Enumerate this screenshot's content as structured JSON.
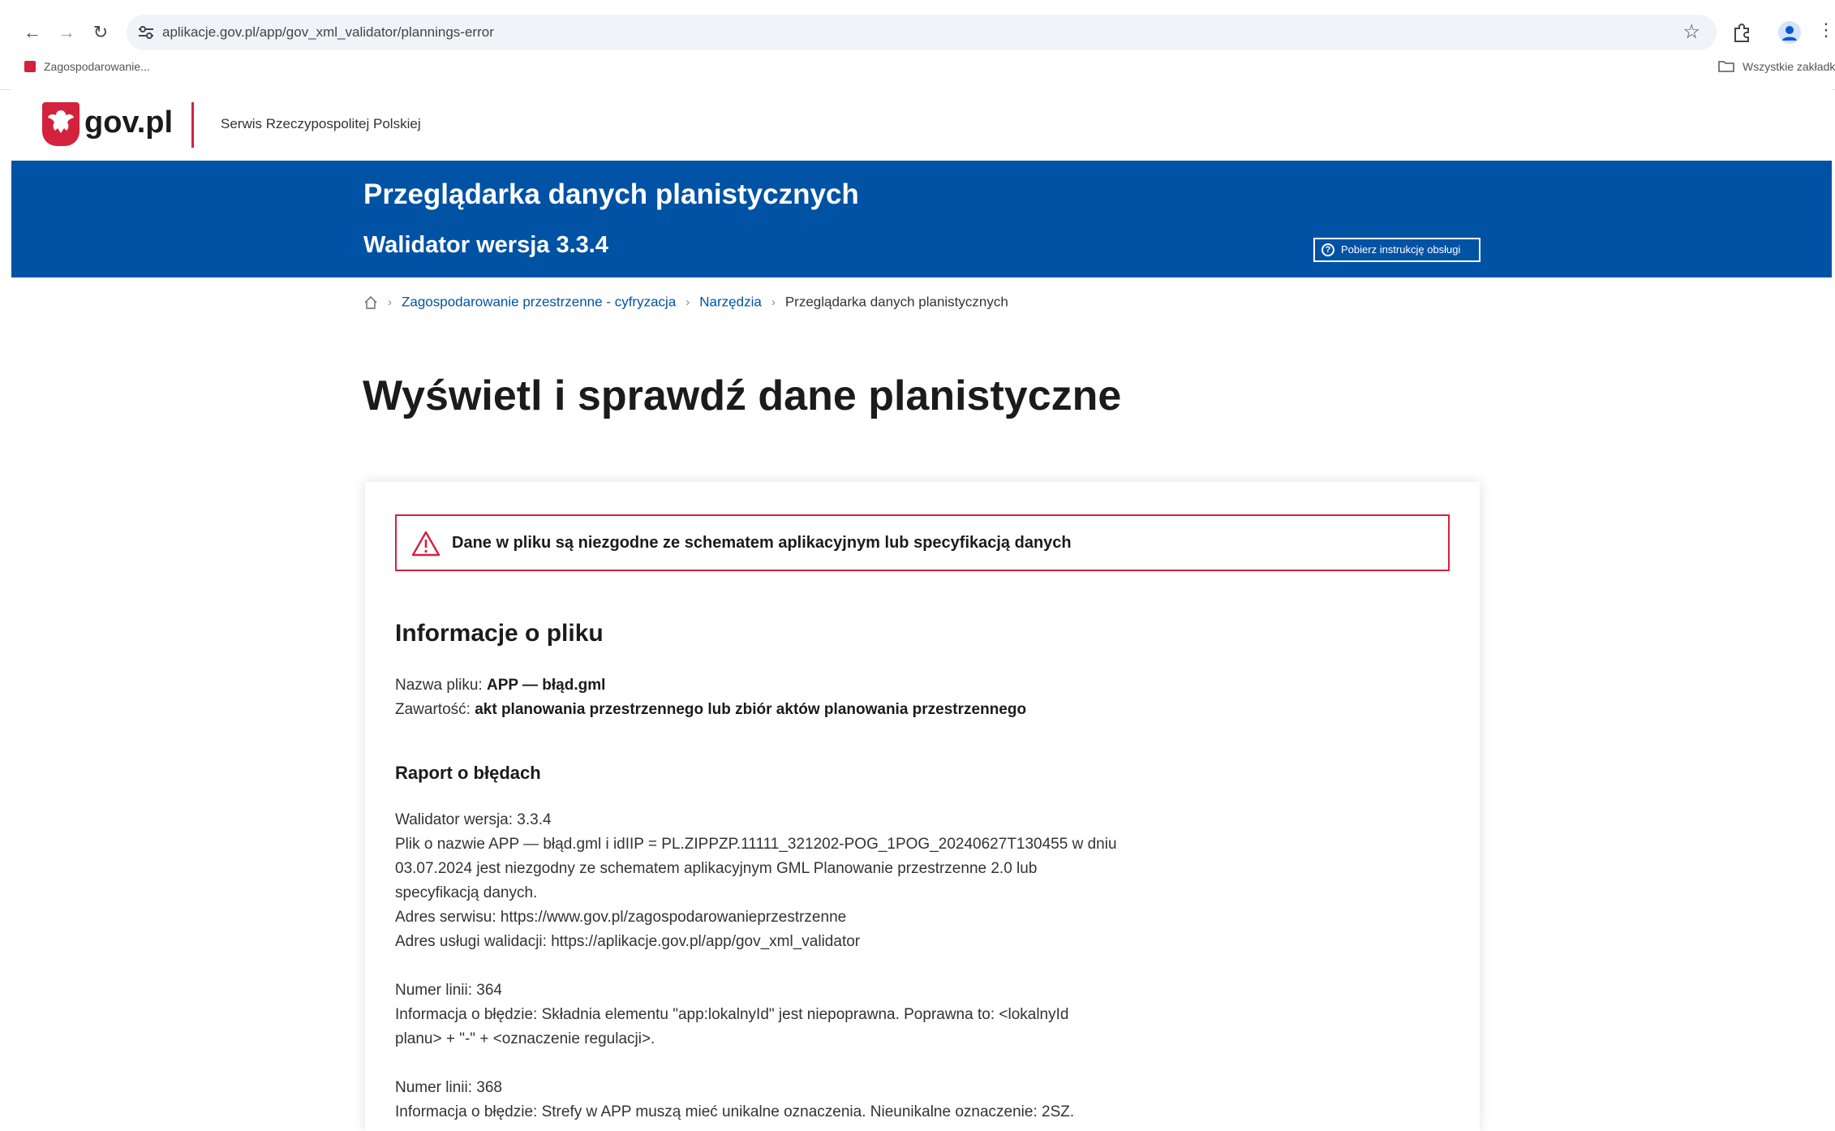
{
  "browser": {
    "url": "aplikacje.gov.pl/app/gov_xml_validator/plannings-error",
    "bookmark": "Zagospodarowanie...",
    "all_bookmarks": "Wszystkie zakładki"
  },
  "gov": {
    "logo_text": "gov.pl",
    "service_name": "Serwis Rzeczypospolitej Polskiej"
  },
  "banner": {
    "title": "Przeglądarka danych planistycznych",
    "subtitle": "Walidator wersja 3.3.4",
    "manual_button": "Pobierz instrukcję obsługi"
  },
  "breadcrumb": {
    "items": [
      "Zagospodarowanie przestrzenne - cyfryzacja",
      "Narzędzia"
    ],
    "current": "Przeglądarka danych planistycznych"
  },
  "page_title": "Wyświetl i sprawdź dane planistyczne",
  "alert": {
    "text": "Dane w pliku są niezgodne ze schematem aplikacyjnym lub specyfikacją danych"
  },
  "file_info": {
    "title": "Informacje o pliku",
    "name_label": "Nazwa pliku:",
    "name_value": "APP — błąd.gml",
    "content_label": "Zawartość:",
    "content_value": "akt planowania przestrzennego lub zbiór aktów planowania przestrzennego"
  },
  "report": {
    "title": "Raport o błędach",
    "summary_lines": [
      "Walidator wersja: 3.3.4",
      "Plik o nazwie APP — błąd.gml i idIIP = PL.ZIPPZP.11111_321202-POG_1POG_20240627T130455 w dniu",
      "03.07.2024 jest niezgodny ze schematem aplikacyjnym GML Planowanie przestrzenne 2.0 lub",
      "specyfikacją danych.",
      "Adres serwisu: https://www.gov.pl/zagospodarowanieprzestrzenne",
      "Adres usługi walidacji: https://aplikacje.gov.pl/app/gov_xml_validator"
    ],
    "error1_lines": [
      "Numer linii: 364",
      "Informacja o błędzie: Składnia elementu \"app:lokalnyId\" jest niepoprawna. Poprawna to: <lokalnyId",
      "planu> + \"-\" + <oznaczenie regulacji>."
    ],
    "error2_lines": [
      "Numer linii: 368",
      "Informacja o błędzie: Strefy w APP muszą mieć unikalne oznaczenia. Nieunikalne oznaczenie: 2SZ."
    ]
  },
  "colors": {
    "gov_blue": "#0052a5",
    "gov_red": "#d4213d"
  }
}
